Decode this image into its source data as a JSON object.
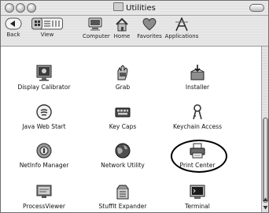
{
  "window": {
    "title": "Utilities"
  },
  "toolbar": {
    "back_label": "Back",
    "view_label": "View",
    "computer_label": "Computer",
    "home_label": "Home",
    "favorites_label": "Favorites",
    "applications_label": "Applications"
  },
  "items": [
    {
      "name": "Display Calibrator",
      "icon": "display-calibrator-icon"
    },
    {
      "name": "Grab",
      "icon": "grab-icon"
    },
    {
      "name": "Installer",
      "icon": "installer-icon"
    },
    {
      "name": "Java Web Start",
      "icon": "java-icon"
    },
    {
      "name": "Key Caps",
      "icon": "keyboard-icon"
    },
    {
      "name": "Keychain Access",
      "icon": "keychain-icon"
    },
    {
      "name": "NetInfo Manager",
      "icon": "netinfo-icon"
    },
    {
      "name": "Network Utility",
      "icon": "globe-icon"
    },
    {
      "name": "Print Center",
      "icon": "printer-icon"
    },
    {
      "name": "ProcessViewer",
      "icon": "process-viewer-icon"
    },
    {
      "name": "StuffIt Expander",
      "icon": "stuffit-icon"
    },
    {
      "name": "Terminal",
      "icon": "terminal-icon"
    }
  ],
  "highlighted_item": "Print Center"
}
